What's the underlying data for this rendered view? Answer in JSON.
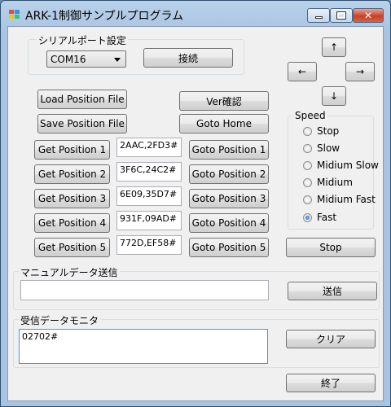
{
  "window": {
    "title": "ARK-1制御サンプルプログラム"
  },
  "serial": {
    "group_label": "シリアルポート設定",
    "port_value": "COM16",
    "connect_label": "接続"
  },
  "file": {
    "load_label": "Load Position File",
    "save_label": "Save Position File"
  },
  "top": {
    "ver_label": "Ver確認",
    "home_label": "Goto Home"
  },
  "positions": [
    {
      "get_label": "Get Position 1",
      "value": "2AAC,2FD3#",
      "goto_label": "Goto Position 1"
    },
    {
      "get_label": "Get Position 2",
      "value": "3F6C,24C2#",
      "goto_label": "Goto Position 2"
    },
    {
      "get_label": "Get Position 3",
      "value": "6E09,35D7#",
      "goto_label": "Goto Position 3"
    },
    {
      "get_label": "Get Position 4",
      "value": "931F,09AD#",
      "goto_label": "Goto Position 4"
    },
    {
      "get_label": "Get Position 5",
      "value": "772D,EF58#",
      "goto_label": "Goto Position 5"
    }
  ],
  "arrows": {
    "up": "↑",
    "down": "↓",
    "left": "←",
    "right": "→"
  },
  "speed": {
    "label": "Speed",
    "options": [
      "Stop",
      "Slow",
      "Midium Slow",
      "Midium",
      "Midium Fast",
      "Fast"
    ],
    "selected": "Fast"
  },
  "stop_label": "Stop",
  "manual": {
    "label": "マニュアルデータ送信",
    "input_value": "",
    "send_label": "送信"
  },
  "monitor": {
    "label": "受信データモニタ",
    "text": "02702#",
    "clear_label": "クリア"
  },
  "exit_label": "終了",
  "colors": {
    "titlebar": "#b9d1ea",
    "close": "#c5432b",
    "face": "#f0f0f0",
    "radio_on": "#1d5fb8"
  }
}
